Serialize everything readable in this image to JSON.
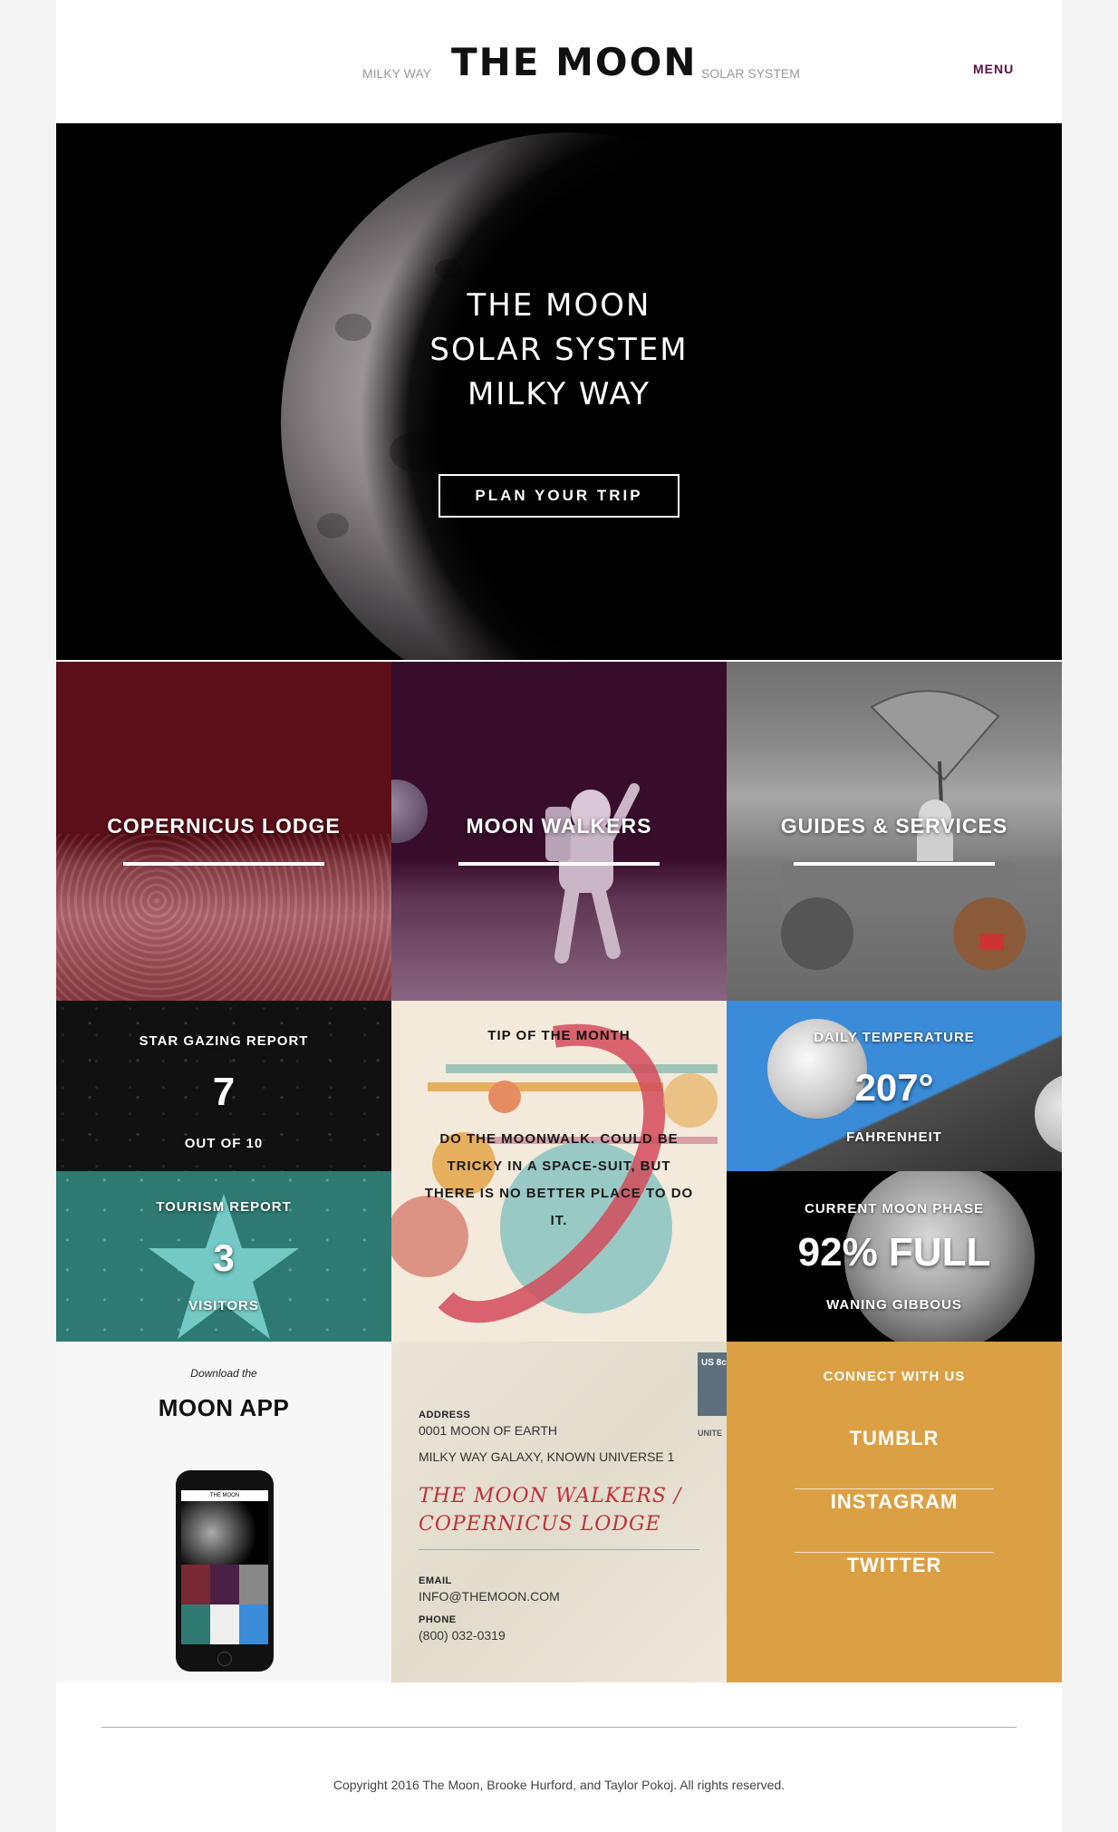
{
  "header": {
    "nav_left": "MILKY WAY",
    "brand": "THE MOON",
    "nav_right": "SOLAR SYSTEM",
    "menu": "MENU"
  },
  "hero": {
    "line1": "THE MOON",
    "line2": "SOLAR SYSTEM",
    "line3": "MILKY WAY",
    "cta": "PLAN YOUR TRIP"
  },
  "features": [
    {
      "title": "COPERNICUS LODGE",
      "color": "#5a0f17"
    },
    {
      "title": "MOON WALKERS",
      "color": "#380d2c"
    },
    {
      "title": "GUIDES & SERVICES",
      "color": "#777777"
    }
  ],
  "stargazing": {
    "label": "STAR GAZING REPORT",
    "value": "7",
    "sub": "OUT OF 10"
  },
  "tip": {
    "label": "TIP OF THE MONTH",
    "text": "DO THE MOONWALK. COULD BE TRICKY IN A SPACE-SUIT, BUT THERE IS NO BETTER PLACE TO DO IT."
  },
  "temperature": {
    "label": "DAILY TEMPERATURE",
    "value": "207°",
    "unit": "FAHRENHEIT"
  },
  "tourism": {
    "label": "TOURISM REPORT",
    "value": "3",
    "sub": "VISITORS"
  },
  "moon_phase": {
    "label": "CURRENT MOON PHASE",
    "value": "92% FULL",
    "sub": "WANING GIBBOUS"
  },
  "app": {
    "kicker": "Download the",
    "title": "MOON APP",
    "screen_brand": "THE MOON"
  },
  "contact": {
    "address_label": "ADDRESS",
    "address_line1": "0001 MOON OF EARTH",
    "address_line2": "MILKY WAY GALAXY, KNOWN UNIVERSE 1",
    "script_line1": "THE MOON WALKERS /",
    "script_line2": "COPERNICUS LODGE",
    "email_label": "EMAIL",
    "email": "INFO@THEMOON.COM",
    "phone_label": "PHONE",
    "phone": "(800) 032-0319",
    "stamp_text": "US 8c",
    "stamp_word": "UNITE"
  },
  "social": {
    "label": "CONNECT WITH US",
    "links": [
      "TUMBLR",
      "INSTAGRAM",
      "TWITTER"
    ],
    "color": "#dca044"
  },
  "footer": {
    "copyright": "Copyright 2016 The Moon, Brooke Hurford, and Taylor Pokoj. All rights reserved."
  }
}
